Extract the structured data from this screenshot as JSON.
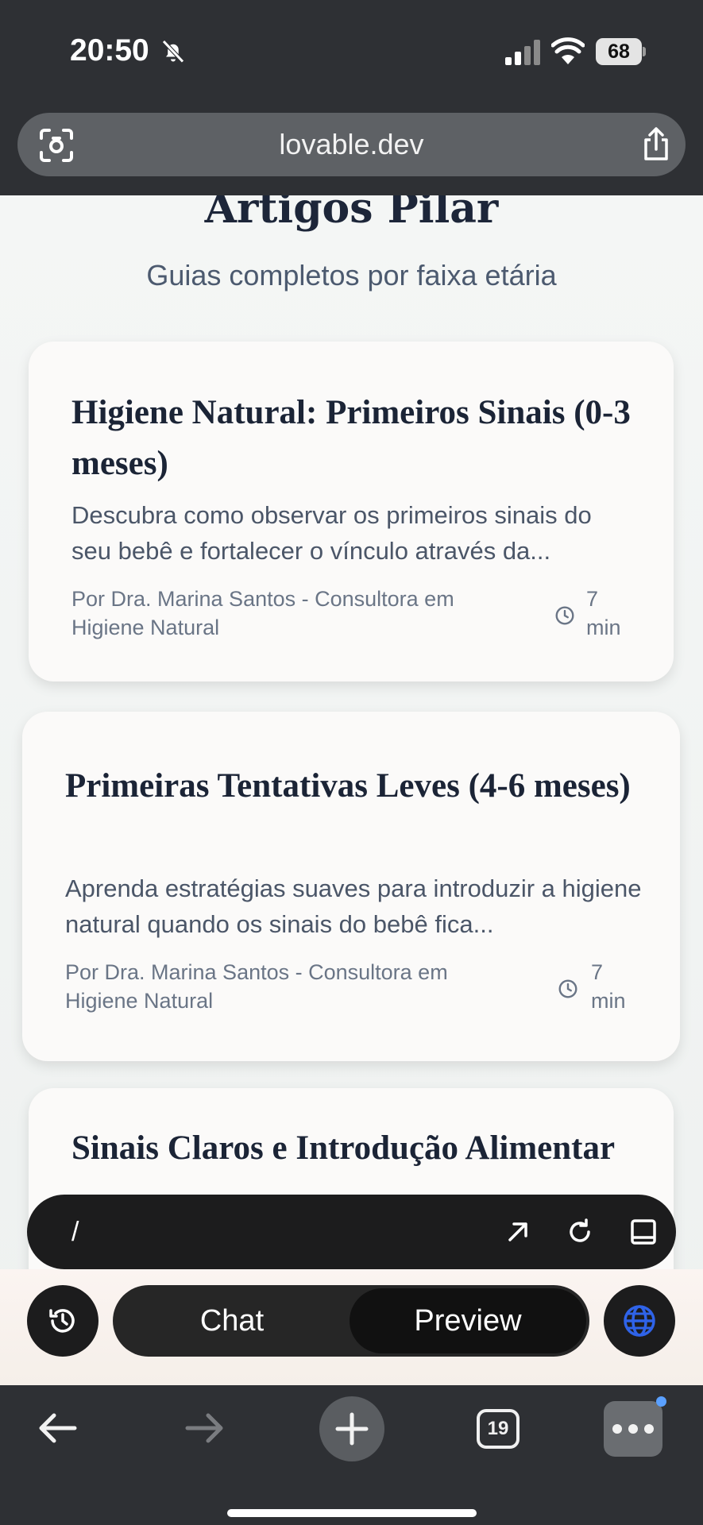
{
  "status_bar": {
    "time": "20:50",
    "battery": "68"
  },
  "browser": {
    "url": "lovable.dev"
  },
  "page": {
    "title": "Artigos Pilar",
    "subtitle": "Guias completos por faixa etária"
  },
  "articles": [
    {
      "title": "Higiene Natural: Primeiros Sinais (0-3 meses)",
      "description": "Descubra como observar os primeiros sinais do seu bebê e fortalecer o vínculo através da...",
      "author": "Por Dra. Marina Santos - Consultora em Higiene Natural",
      "read_time": "7 min"
    },
    {
      "title": "Primeiras Tentativas Leves (4-6 meses)",
      "description": "Aprenda estratégias suaves para introduzir a higiene natural quando os sinais do bebê fica...",
      "author": "Por Dra. Marina Santos - Consultora em Higiene Natural",
      "read_time": "7 min"
    },
    {
      "title": "Sinais Claros e Introdução Alimentar"
    }
  ],
  "app_bar": {
    "path": "/",
    "chat_label": "Chat",
    "preview_label": "Preview",
    "active_tab": "Preview"
  },
  "toolbar": {
    "tab_count": "19"
  },
  "colors": {
    "chrome": "#2e3034",
    "pill": "#1c1c1d",
    "globe_accent": "#2f63e8",
    "notification_dot": "#5aa0ff"
  }
}
